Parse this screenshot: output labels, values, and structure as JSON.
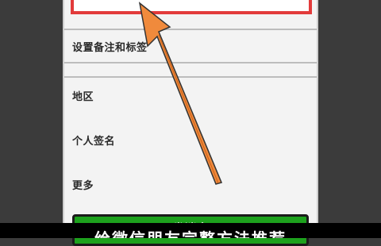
{
  "settings": {
    "rows": {
      "tags": "设置备注和标签",
      "region": "地区",
      "signature": "个人签名",
      "more": "更多"
    },
    "send_message_label": "发消息"
  },
  "caption": {
    "text": "给微信朋友完整方法推荐"
  },
  "colors": {
    "highlight_box": "#e23b3b",
    "send_button": "#1da11d",
    "arrow": "#f08a3c"
  }
}
